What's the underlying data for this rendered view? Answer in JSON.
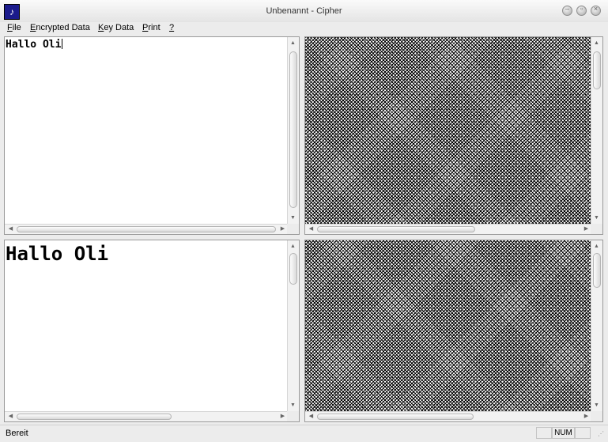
{
  "window": {
    "title": "Unbenannt - Cipher",
    "icon": "cipher-app-icon",
    "icon_glyph": "♪",
    "buttons": [
      "minimize",
      "maximize",
      "close"
    ]
  },
  "menu": {
    "file": {
      "accel": "F",
      "rest": "ile"
    },
    "encrypted": {
      "accel": "E",
      "rest": "ncrypted Data"
    },
    "key": {
      "accel": "K",
      "rest": "ey Data"
    },
    "print": {
      "accel": "P",
      "rest": "rint"
    },
    "help": {
      "accel": "?",
      "rest": ""
    }
  },
  "panes": {
    "plain_input": {
      "text": "Hallo Oli"
    },
    "plain_output": {
      "text": "Hallo Oli"
    }
  },
  "status": {
    "text": "Bereit",
    "num": "NUM"
  },
  "colors": {
    "window_bg": "#ececec",
    "pane_bg": "#ffffff",
    "noise": "#000000"
  }
}
